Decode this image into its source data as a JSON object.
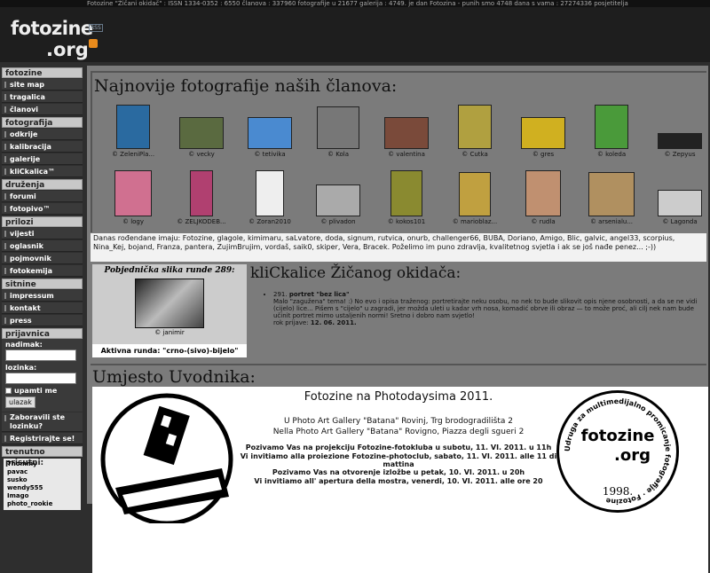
{
  "topbar": "Fotozine \"Žičani okidač\" : ISSN 1334-0352 : 6550 članova : 337960 fotografije u 21677 galerija : 4749. je dan Fotozina - punih smo 4748 dana s vama : 27274336 posjetitelja",
  "logo": {
    "line1": "fotozine",
    "line2": ".org",
    "rss": "RSS"
  },
  "sidebar": {
    "fotozine": {
      "title": "fotozine",
      "items": [
        "site map",
        "tragalica",
        "članovi"
      ]
    },
    "fotografija": {
      "title": "fotografija",
      "items": [
        "odkrije",
        "kalibracija",
        "galerije",
        "kliCkalica™"
      ]
    },
    "druzenja": {
      "title": "druženja",
      "items": [
        "forumi",
        "fotopivo™"
      ]
    },
    "prilozi": {
      "title": "prilozi",
      "items": [
        "vijesti",
        "oglasnik",
        "pojmovnik",
        "fotokemija"
      ]
    },
    "sitnine": {
      "title": "sitnine",
      "items": [
        "impressum",
        "kontakt",
        "press"
      ]
    },
    "login": {
      "title": "prijavnica",
      "user_label": "nadimak:",
      "pass_label": "lozinka:",
      "remember": "upamti me",
      "submit": "ulazak",
      "forgot": "Zaboravili ste lozinku?",
      "register": "Registrirajte se!"
    },
    "online": {
      "title": "trenutno prisutni:",
      "users": [
        "Thommy",
        "pavac",
        "susko",
        "wendy555",
        "Imago",
        "photo_rookie"
      ]
    }
  },
  "photos": {
    "title": "Najnovije fotografije naših članova:",
    "row1": [
      {
        "name": "© ZeleniPla...",
        "c": "#2a6aa0"
      },
      {
        "name": "© vecky",
        "c": "#5a6a40"
      },
      {
        "name": "© tetivika",
        "c": "#4a8ad0"
      },
      {
        "name": "© Kola",
        "c": "#777"
      },
      {
        "name": "© valentina",
        "c": "#7a4a3a"
      },
      {
        "name": "© Cutka",
        "c": "#b0a040"
      },
      {
        "name": "© gres",
        "c": "#d0b020"
      },
      {
        "name": "© koleda",
        "c": "#4a9a3a"
      },
      {
        "name": "© Zepyus",
        "c": "#222"
      }
    ],
    "row2": [
      {
        "name": "© logy",
        "c": "#d07090"
      },
      {
        "name": "© ZELJKODEB...",
        "c": "#b04070"
      },
      {
        "name": "© Zoran2010",
        "c": "#eee"
      },
      {
        "name": "© plivadon",
        "c": "#aaa"
      },
      {
        "name": "© kokos101",
        "c": "#8a8a30"
      },
      {
        "name": "© marioblaz...",
        "c": "#c0a040"
      },
      {
        "name": "© rudla",
        "c": "#c09070"
      },
      {
        "name": "© arsenialu...",
        "c": "#b09060"
      },
      {
        "name": "© Lagonda",
        "c": "#ccc"
      }
    ]
  },
  "birthday": "Danas rođendane imaju: Fotozine, glagole, kimimaru, saLvatore, doda, signum, rutvica, onurb, challenger66, BUBA, Doriano, Amigo, Blic, galvic, angel33, scorpius, Nina_Kej, bojand, Franza, pantera, ZujimBrujim, vordaš, saik0, skiper, Vera, Bracek. Poželimo im puno zdravlja, kvalitetnog svjetla i ak se još nađe penez... ;-))",
  "winner": {
    "title": "Pobjednička slika runde 289:",
    "caption": "© janimir",
    "active": "Aktivna runda: \"crno-(sivo)-bijelo\""
  },
  "klick": {
    "title": "kliCkalice Žičanog okidača:",
    "num": "291.",
    "topic": "portret \"bez lica\"",
    "desc": "Malo \"zagužena\" tema! :) No evo i opisa traženog: portretirajte neku osobu, no nek to bude slikovit opis njene osobnosti, a da se ne vidi (cijelo) lice... Pišem s \"cijelo\" u zagradi, jer možda uleti u kadar vrh nosa, komadić obrve ili obraz — to može proć, ali cilj nek nam bude učinit portret mimo ustaljenih normi! Sretno i dobro nam svjetlo!",
    "deadline_label": "rok prijave:",
    "deadline": "12. 06. 2011."
  },
  "intro": {
    "title": "Umjesto Uvodnika:",
    "heading": "Fotozine na Photodaysima 2011.",
    "l1": "U Photo Art Gallery \"Batana\" Rovinj, Trg brodogradilišta 2",
    "l2": "Nella Photo Art Gallery \"Batana\" Rovigno, Piazza degli sgueri 2",
    "l3": "Pozivamo Vas na projekciju Fotozine-fotokluba u subotu, 11. VI. 2011. u 11h",
    "l4": "Vi invitiamo alla proiezione Fotozine-photoclub, sabato, 11. VI. 2011. alle 11 di mattina",
    "l5": "Pozivamo Vas na otvorenje izložbe u petak, 10. VI. 2011. u 20h",
    "l6": "Vi invitiamo all' apertura della mostra, venerdi, 10. VI. 2011. alle ore 20",
    "badge_arc": "Udruga za multimedijalno promicanje fotografije · Fotozine",
    "badge_logo1": "fotozine",
    ".badge_logo2": ".org",
    "badge_year": "1998."
  }
}
